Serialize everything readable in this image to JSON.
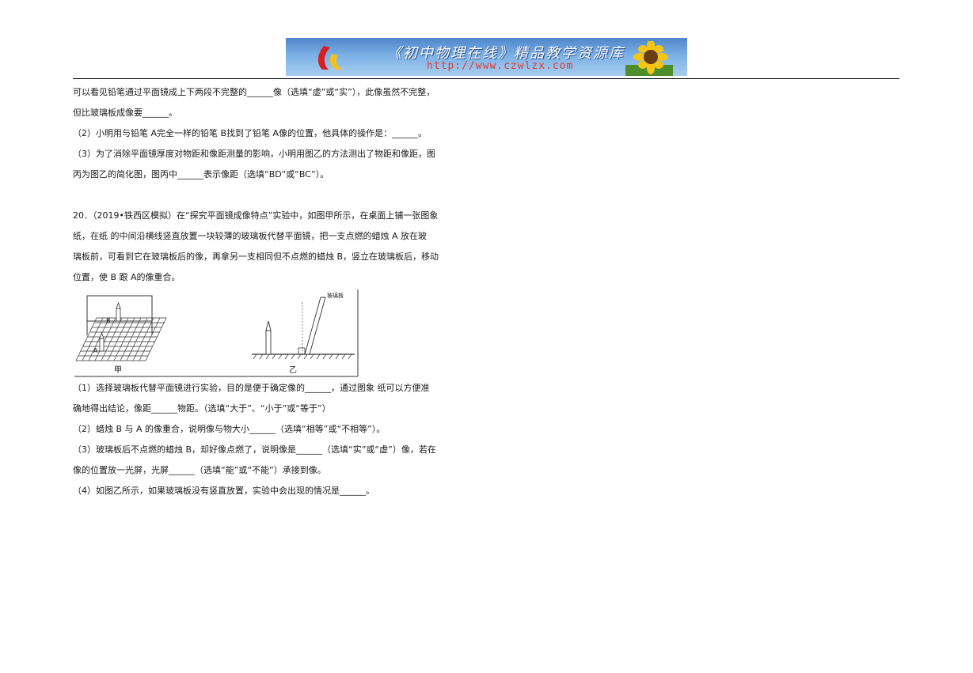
{
  "header": {
    "title": "《初中物理在线》精品教学资源库",
    "url": "http://www.czwlzx.com"
  },
  "q19_tail": {
    "line1": "可以看见铅笔通过平面镜成上下两段不完整的______像（选填“虚”或“实”），此像虽然不完整，",
    "line2": "但比玻璃板成像要______。",
    "line3": "（2）小明用与铅笔 A完全一样的铅笔 B找到了铅笔 A像的位置，他具体的操作是：______。",
    "line4": "（3）为了消除平面镜厚度对物距和像距测量的影响，小明用图乙的方法测出了物距和像距，图",
    "line5": "丙为图乙的简化图，图丙中______表示像距（选填“BD”或“BC”）。"
  },
  "q20": {
    "intro1": "20．（2019•铁西区模拟）在“探究平面镜成像特点”实验中，如图甲所示，在桌面上铺一张图象",
    "intro2": "纸，在纸 的中间沿横线竖直放置一块较薄的玻璃板代替平面镜，把一支点燃的蜡烛 A 放在玻",
    "intro3": "璃板前，可看到它在玻璃板后的像，再拿另一支相同但不点燃的蜡烛 B，竖立在玻璃板后，移动",
    "intro4": "位置，使 B 跟 A的像重合。",
    "figure": {
      "label_jia": "甲",
      "label_yi": "乙",
      "label_glass": "玻璃板",
      "label_a": "A",
      "label_b": "B"
    },
    "s1a": "（1）选择玻璃板代替平面镜进行实验，目的是便于确定像的______，通过图象 纸可以方便准",
    "s1b": "确地得出结论，像距______物距。（选填“大于”、“小于”或“等于”）",
    "s2": "（2）蜡烛 B 与 A 的像重合，说明像与物大小______（选填“相等”或“不相等”）。",
    "s3a": "（3）玻璃板后不点燃的蜡烛 B，却好像点燃了，说明像是______（选填“实”或“虚”）像，若在",
    "s3b": "像的位置放一光屏，光屏______（选填“能”或“不能”）承接到像。",
    "s4": "（4）如图乙所示，如果玻璃板没有竖直放置，实验中会出现的情况是______。"
  }
}
